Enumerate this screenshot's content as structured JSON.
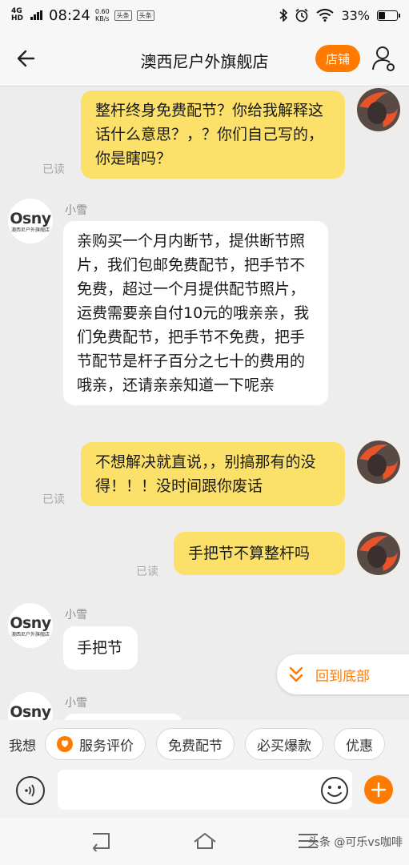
{
  "status_bar": {
    "network": "4G HD",
    "time": "08:24",
    "speed_value": "0.60",
    "speed_unit": "KB/s",
    "app_badge_1": "头条",
    "app_badge_2": "头条",
    "battery": "33%",
    "battery_level": 0.33
  },
  "header": {
    "title": "澳西尼户外旗舰店",
    "shop_button": "店铺"
  },
  "messages": [
    {
      "from": "me",
      "text": "整杆终身免费配节？你给我解释这话什么意思？，？你们自己写的，你是瞎吗？",
      "status": "已读"
    },
    {
      "from": "shop",
      "sender": "小雪",
      "text": "亲购买一个月内断节，提供断节照片，我们包邮免费配节，把手节不免费，超过一个月提供配节照片，运费需要亲自付10元的哦亲亲，我们免费配节，把手节不免费，把手节配节是杆子百分之七十的费用的哦亲，还请亲亲知道一下呢亲"
    },
    {
      "from": "me",
      "text": "不想解决就直说，，别搞那有的没得！！！没时间跟你废话",
      "status": "已读"
    },
    {
      "from": "me",
      "text": "手把节不算整杆吗",
      "status": "已读"
    },
    {
      "from": "shop",
      "sender": "小雪",
      "text": "手把节"
    },
    {
      "from": "shop",
      "sender": "小雪",
      "text": ""
    }
  ],
  "shop_avatar": {
    "logo": "Osny",
    "sub": "澳西尼户外旗舰店"
  },
  "back_to_bottom": "回到底部",
  "quick_bar": {
    "label": "我想",
    "chips": [
      "服务评价",
      "免费配节",
      "必买爆款",
      "优惠"
    ]
  },
  "input": {
    "placeholder": ""
  },
  "watermark": "头条 @可乐vs咖啡",
  "colors": {
    "accent": "#ff7a00",
    "my_bubble": "#fbe06a",
    "their_bubble": "#ffffff",
    "background": "#ededed"
  }
}
